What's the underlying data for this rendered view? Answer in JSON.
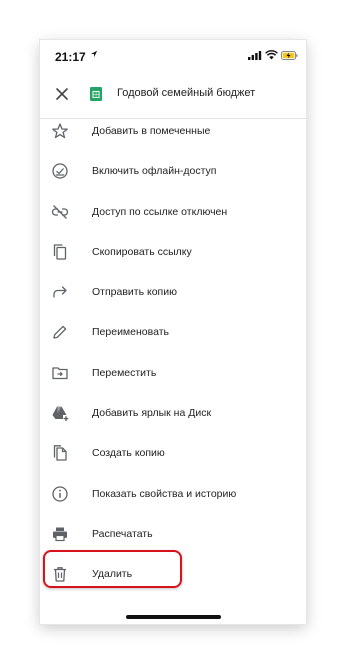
{
  "status_bar": {
    "time": "21:17"
  },
  "header": {
    "title": "Годовой семейный бюджет"
  },
  "menu": {
    "items": [
      {
        "label": "Добавить в помеченные",
        "icon": "star-icon"
      },
      {
        "label": "Включить офлайн-доступ",
        "icon": "offline-check-icon"
      },
      {
        "label": "Доступ по ссылке отключен",
        "icon": "link-off-icon"
      },
      {
        "label": "Скопировать ссылку",
        "icon": "copy-icon"
      },
      {
        "label": "Отправить копию",
        "icon": "forward-arrow-icon"
      },
      {
        "label": "Переименовать",
        "icon": "pencil-icon"
      },
      {
        "label": "Переместить",
        "icon": "move-folder-icon"
      },
      {
        "label": "Добавить ярлык на Диск",
        "icon": "drive-shortcut-icon"
      },
      {
        "label": "Создать копию",
        "icon": "file-copy-icon"
      },
      {
        "label": "Показать свойства и историю",
        "icon": "info-icon"
      },
      {
        "label": "Распечатать",
        "icon": "printer-icon"
      },
      {
        "label": "Удалить",
        "icon": "trash-icon"
      }
    ]
  },
  "colors": {
    "highlight": "#d8121d",
    "sheets_green": "#23a566"
  }
}
